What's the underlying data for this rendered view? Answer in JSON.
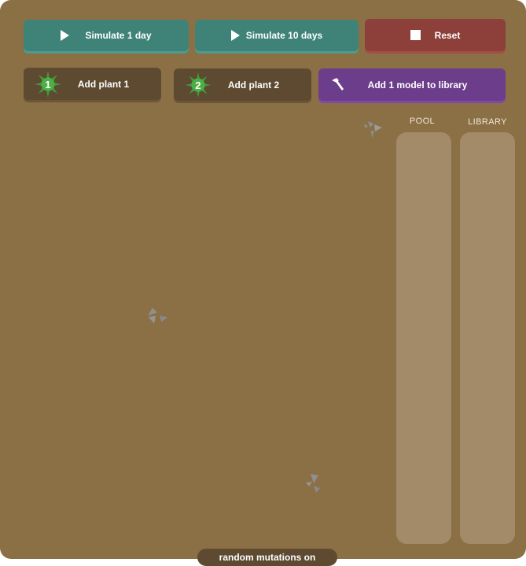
{
  "toolbar": {
    "simulate_1_day_label": "Simulate 1 day",
    "simulate_10_days_label": "Simulate 10 days",
    "reset_label": "Reset",
    "add_plant_1_label": "Add plant 1",
    "add_plant_1_badge": "1",
    "add_plant_2_label": "Add plant 2",
    "add_plant_2_badge": "2",
    "add_model_label": "Add 1 model to library"
  },
  "columns": {
    "pool_label": "POOL",
    "library_label": "LIBRARY"
  },
  "status": {
    "mutations_label": "random mutations on"
  },
  "icons": [
    "play-icon",
    "stop-icon",
    "plant-icon",
    "hammer-icon",
    "rock-icon"
  ],
  "colors": {
    "board": "#8b6f45",
    "teal_button": "#3f8378",
    "red_button": "#8d3f3a",
    "dark_button": "#5d4a31",
    "purple_button": "#6b3d8a",
    "column": "#a38a69",
    "plant_green": "#3f9b3a"
  }
}
